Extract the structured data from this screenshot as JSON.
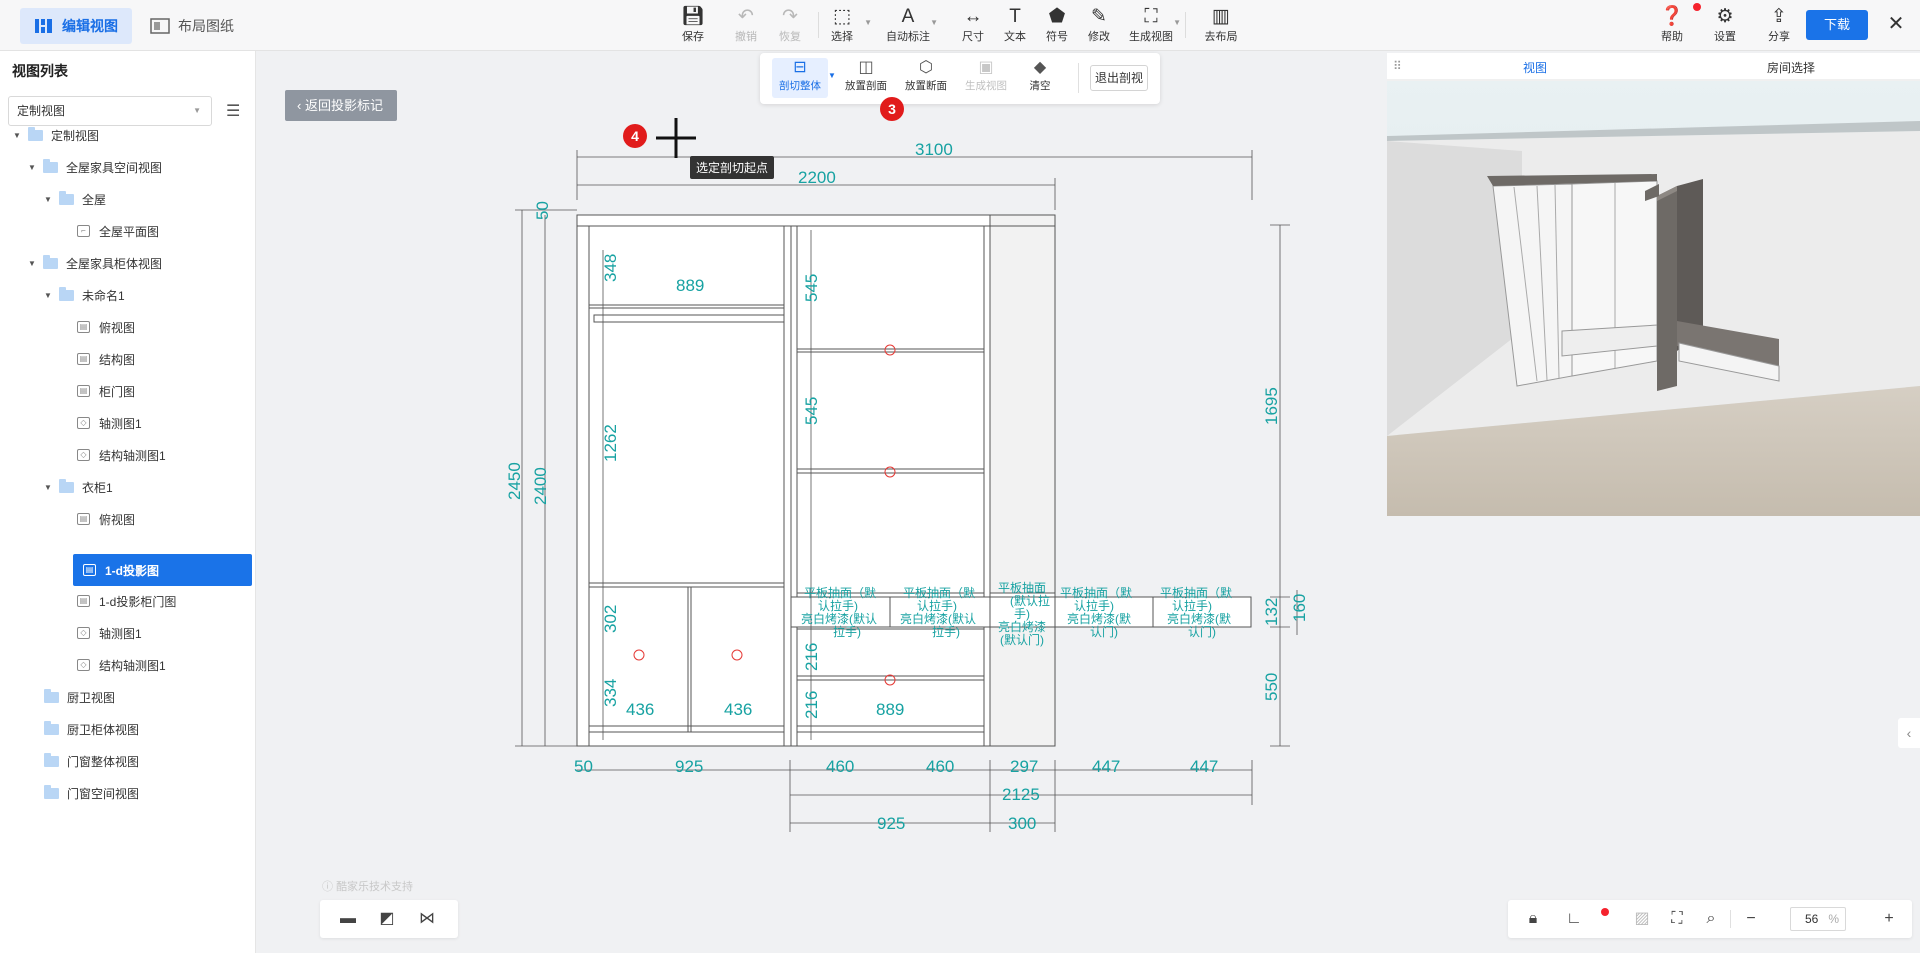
{
  "topbar": {
    "tabs": [
      {
        "label": "编辑视图"
      },
      {
        "label": "布局图纸"
      }
    ],
    "tools": [
      {
        "label": "保存",
        "icon": "save-icon"
      },
      {
        "label": "撤销",
        "icon": "undo-icon"
      },
      {
        "label": "恢复",
        "icon": "redo-icon"
      },
      {
        "label": "选择",
        "icon": "select-icon"
      },
      {
        "label": "自动标注",
        "icon": "auto-annotate-icon"
      },
      {
        "label": "尺寸",
        "icon": "dimension-icon"
      },
      {
        "label": "文本",
        "icon": "text-icon"
      },
      {
        "label": "符号",
        "icon": "symbol-icon"
      },
      {
        "label": "修改",
        "icon": "edit-icon"
      },
      {
        "label": "生成视图",
        "icon": "generate-view-icon"
      },
      {
        "label": "去布局",
        "icon": "layout-icon"
      }
    ],
    "right_tools": [
      {
        "label": "帮助",
        "icon": "help-icon"
      },
      {
        "label": "设置",
        "icon": "settings-icon"
      },
      {
        "label": "分享",
        "icon": "share-icon"
      }
    ],
    "download_label": "下载"
  },
  "sidebar": {
    "title": "视图列表",
    "select_value": "定制视图",
    "tree": [
      {
        "label": "定制视图"
      },
      {
        "label": "全屋家具空间视图"
      },
      {
        "label": "全屋"
      },
      {
        "label": "全屋平面图"
      },
      {
        "label": "全屋家具柜体视图"
      },
      {
        "label": "未命名1"
      },
      {
        "label": "俯视图"
      },
      {
        "label": "结构图"
      },
      {
        "label": "柜门图"
      },
      {
        "label": "轴测图1"
      },
      {
        "label": "结构轴测图1"
      },
      {
        "label": "衣柜1"
      },
      {
        "label": "俯视图"
      },
      {
        "label": "1-d投影图"
      },
      {
        "label": "1-d投影柜门图"
      },
      {
        "label": "轴测图1"
      },
      {
        "label": "结构轴测图1"
      },
      {
        "label": "厨卫视图"
      },
      {
        "label": "厨卫柜体视图"
      },
      {
        "label": "门窗整体视图"
      },
      {
        "label": "门窗空间视图"
      }
    ]
  },
  "canvas": {
    "back_label": "返回投影标记",
    "cut_tools": [
      {
        "label": "剖切整体",
        "icon": "cut-whole-icon"
      },
      {
        "label": "放置剖面",
        "icon": "place-section-icon"
      },
      {
        "label": "放置断面",
        "icon": "place-break-icon"
      },
      {
        "label": "生成视图",
        "icon": "generate-icon"
      },
      {
        "label": "清空",
        "icon": "clear-icon"
      }
    ],
    "exit_label": "退出剖视",
    "badges": [
      "3",
      "4"
    ],
    "tooltip": "选定剖切起点",
    "watermark": "酷家乐技术支持"
  },
  "drawing": {
    "dims_top": [
      "3100",
      "2200"
    ],
    "dims_inner": [
      "889",
      "348",
      "545",
      "545",
      "1262",
      "302",
      "334",
      "436",
      "436",
      "216",
      "216",
      "889"
    ],
    "dims_left": [
      "50",
      "2450",
      "2400"
    ],
    "dims_right": [
      "1695",
      "132",
      "160",
      "550"
    ],
    "dims_bottom1": [
      "50",
      "925",
      "460",
      "460",
      "297",
      "447",
      "447"
    ],
    "dims_bottom2": [
      "2125"
    ],
    "dims_bottom3": [
      "925",
      "300"
    ],
    "drawer_labels": [
      [
        "平板抽面（默",
        "认拉手)",
        "亮白烤漆(默认",
        "拉手)"
      ],
      [
        "平板抽面（默",
        "认拉手)",
        "亮白烤漆(默认",
        "拉手)"
      ],
      [
        "平板抽面",
        "(默认拉",
        "手)",
        "亮白烤漆",
        "(默认门)"
      ],
      [
        "平板抽面（默",
        "认拉手)",
        "亮白烤漆(默",
        "认门)"
      ],
      [
        "平板抽面（默",
        "认拉手)",
        "亮白烤漆(默",
        "认门)"
      ]
    ]
  },
  "preview": {
    "tabs": [
      {
        "label": "视图"
      },
      {
        "label": "房间选择"
      }
    ]
  },
  "bottom": {
    "zoom_value": "56",
    "zoom_unit": "%"
  },
  "colors": {
    "accent": "#1a73e8",
    "dimension": "#17a2a2",
    "badge": "#e11b1b"
  }
}
